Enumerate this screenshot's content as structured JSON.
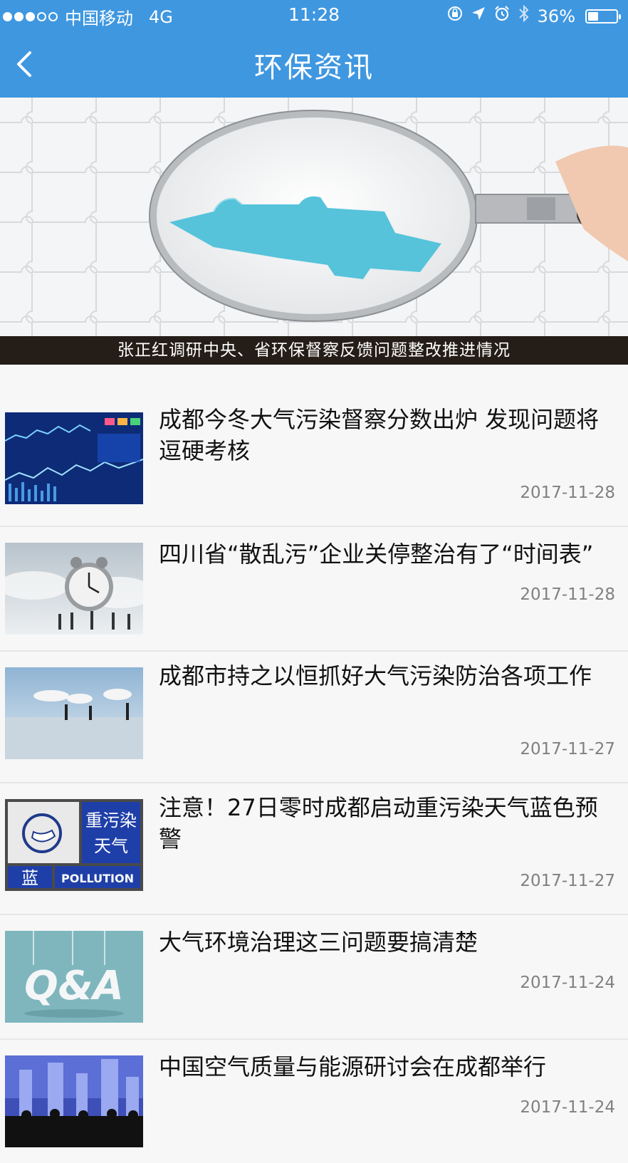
{
  "status_bar": {
    "carrier": "中国移动",
    "network": "4G",
    "time": "11:28",
    "battery": "36%",
    "battery_level": 0.36,
    "icons": [
      "orientation-lock-icon",
      "location-arrow-icon",
      "alarm-icon",
      "bluetooth-icon"
    ]
  },
  "nav": {
    "title": "环保资讯",
    "back_icon": "chevron-left-icon"
  },
  "banner": {
    "caption": "张正红调研中央、省环保督察反馈问题整改推进情况"
  },
  "news": [
    {
      "title": "成都今冬大气污染督察分数出炉 发现问题将逗硬考核",
      "date": "2017-11-28",
      "thumb": "stock-chart"
    },
    {
      "title": "四川省“散乱污”企业关停整治有了“时间表”",
      "date": "2017-11-28",
      "thumb": "alarm-clock"
    },
    {
      "title": "成都市持之以恒抓好大气污染防治各项工作",
      "date": "2017-11-27",
      "thumb": "chimneys"
    },
    {
      "title": "注意！27日零时成都启动重污染天气蓝色预警",
      "date": "2017-11-27",
      "thumb": "pollution-warning",
      "thumb_text": {
        "line1": "重污染",
        "line2": "天气",
        "level": "蓝",
        "word": "POLLUTION"
      }
    },
    {
      "title": "大气环境治理这三问题要搞清楚",
      "date": "2017-11-24",
      "thumb": "qa",
      "thumb_text": {
        "word": "Q&A"
      }
    },
    {
      "title": "中国空气质量与能源研讨会在成都举行",
      "date": "2017-11-24",
      "thumb": "city-skyline"
    }
  ],
  "colors": {
    "header": "#3f97e0",
    "caption_bg": "#251d17",
    "date": "#808080"
  }
}
